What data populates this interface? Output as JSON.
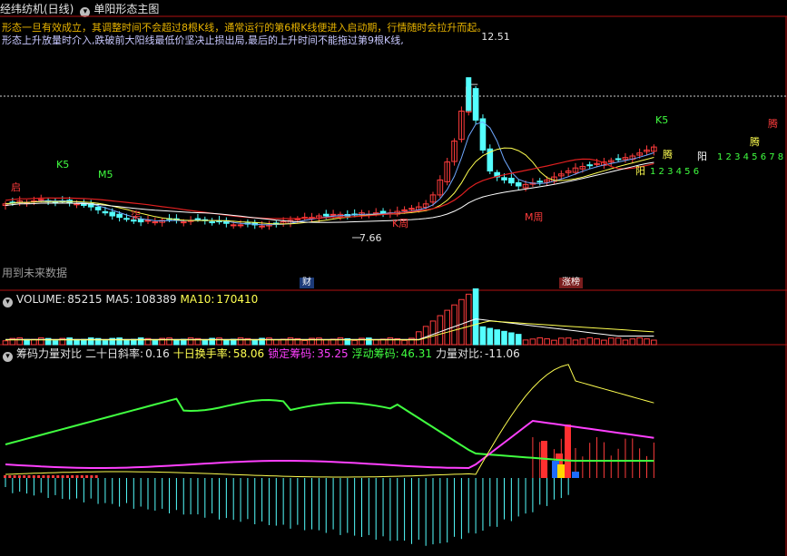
{
  "header": {
    "stock_name": "经纬纺机(日线)",
    "indicator_name": "单阳形态主图",
    "note_line1": "形态一旦有效成立，其调整时间不会超过8根K线，通常运行的第6根K线便进入启动期，行情随时会拉升而起。",
    "note_line2": "形态上升放量时介入,跌破前大阳线最低价坚决止损出局,最后的上升时间不能拖过第9根K线,"
  },
  "main_panel": {
    "peak_price": "12.51",
    "low_price": "7.66",
    "future_label": "用到未来数据",
    "tag_cai": "财",
    "tag_zhangbang": "涨榜",
    "labels": {
      "qi": "启",
      "k5": "K5",
      "m5": "M5",
      "cai_red": "柒",
      "k_zhou": "K周",
      "m_zhou": "M周",
      "k5_right": "K5",
      "teng1": "腾",
      "teng2": "腾",
      "teng3": "腾",
      "yang1": "阳",
      "yang2": "阳",
      "count1": "1 2 3 4 5 6",
      "count2": "1 2 3 4 5 6 7 8 9"
    }
  },
  "volume_panel": {
    "title": "VOLUME:",
    "volume": "85215",
    "ma5_label": "MA5:",
    "ma5": "108389",
    "ma10_label": "MA10:",
    "ma10": "170410"
  },
  "chip_panel": {
    "title": "筹码力量对比",
    "slope_label": "二十日斜率:",
    "slope": "0.16",
    "turnover_label": "十日换手率:",
    "turnover": "58.06",
    "locked_label": "锁定筹码:",
    "locked": "35.25",
    "floating_label": "浮动筹码:",
    "floating": "46.31",
    "power_label": "力量对比:",
    "power": "-11.06"
  },
  "colors": {
    "up": "#ff3c3c",
    "down": "#54ffff",
    "ma_white": "#ffffff",
    "ma_yellow": "#ffff50",
    "ma_red": "#e02020",
    "green": "#40ff40",
    "magenta": "#ff40ff",
    "grid": "#b01010"
  },
  "chart_data": {
    "type": "candlestick",
    "bars": 110,
    "close_start_level": "approx 8.5",
    "lowest_close": "7.66",
    "highest_high": "12.51",
    "price_series_close_approx": [
      8.4,
      8.45,
      8.5,
      8.45,
      8.5,
      8.55,
      8.5,
      8.45,
      8.5,
      8.45,
      8.4,
      8.35,
      8.3,
      8.2,
      8.1,
      8.0,
      7.95,
      7.9,
      7.85,
      7.8,
      7.85,
      7.8,
      7.85,
      7.9,
      7.85,
      7.8,
      7.85,
      7.9,
      7.85,
      7.8,
      7.8,
      7.75,
      7.7,
      7.7,
      7.75,
      7.7,
      7.66,
      7.7,
      7.75,
      7.8,
      7.85,
      7.9,
      7.95,
      7.95,
      8.0,
      8.0,
      8.05,
      8.05,
      8.0,
      8.05,
      8.1,
      8.05,
      8.1,
      8.1,
      8.1,
      8.15,
      8.2,
      8.25,
      8.3,
      8.4,
      8.7,
      9.2,
      9.8,
      10.5,
      11.5,
      12.3,
      11.2,
      10.2,
      9.5,
      9.3,
      9.2,
      9.1,
      9.0,
      9.05,
      9.1,
      9.15,
      9.2,
      9.3,
      9.4,
      9.5,
      9.6,
      9.65,
      9.7,
      9.75,
      9.8,
      9.85,
      9.9,
      9.95,
      10.0,
      10.1,
      10.2,
      10.3
    ],
    "volume_note": "tall spikes during rally bars near x 600-640",
    "lines": [
      "MA white",
      "MA yellow",
      "MA red",
      "green chip line",
      "magenta chip line",
      "yellow chip line"
    ]
  }
}
